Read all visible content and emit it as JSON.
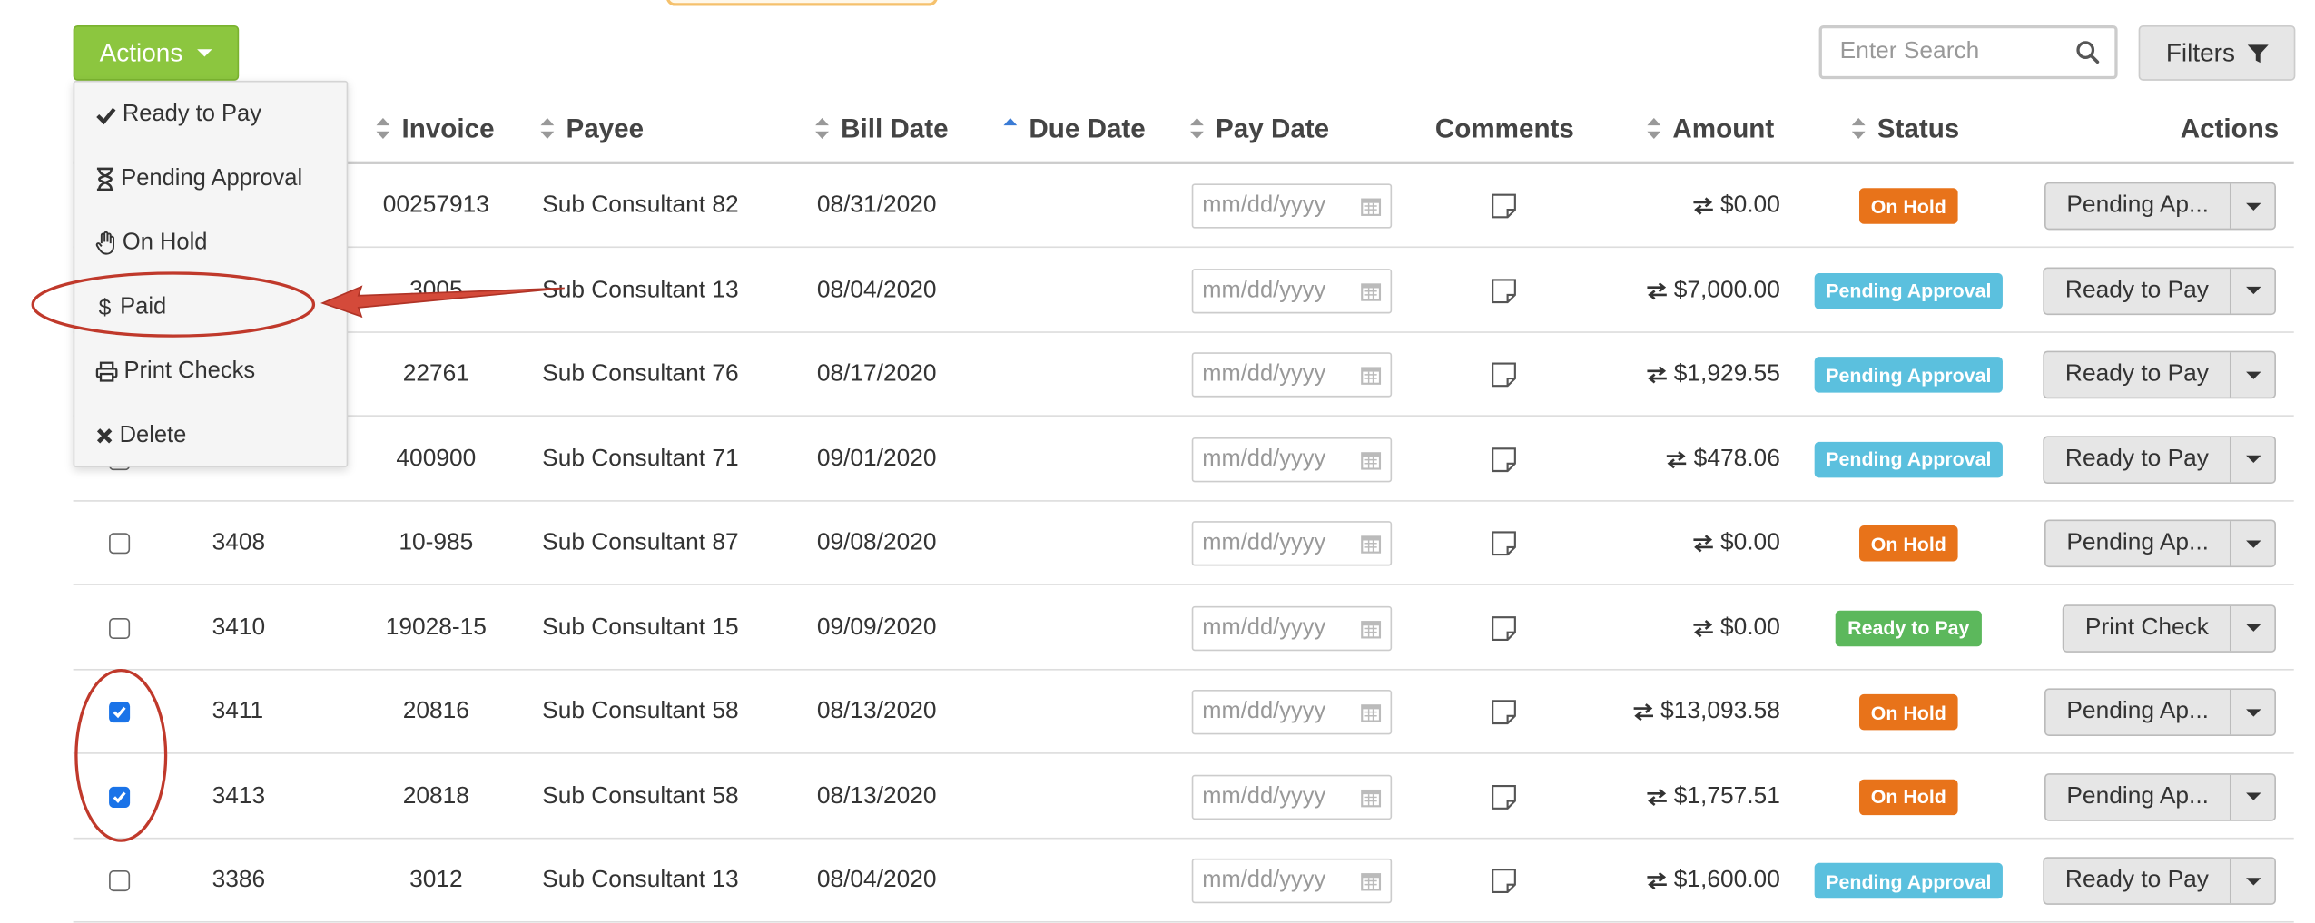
{
  "toolbar": {
    "actions_label": "Actions",
    "search_placeholder": "Enter Search",
    "filters_label": "Filters"
  },
  "actions_menu": [
    {
      "label": "Ready to Pay",
      "icon": "check-icon"
    },
    {
      "label": "Pending Approval",
      "icon": "hourglass-icon"
    },
    {
      "label": "On Hold",
      "icon": "hand-icon"
    },
    {
      "label": "Paid",
      "icon": "dollar-icon"
    },
    {
      "label": "Print Checks",
      "icon": "printer-icon"
    },
    {
      "label": "Delete",
      "icon": "times-icon"
    }
  ],
  "table": {
    "headers": {
      "invoice": "Invoice",
      "payee": "Payee",
      "bill_date": "Bill Date",
      "due_date": "Due Date",
      "pay_date": "Pay Date",
      "comments": "Comments",
      "amount": "Amount",
      "status": "Status",
      "actions": "Actions"
    },
    "date_placeholder": "mm/dd/yyyy",
    "rows": [
      {
        "checked": false,
        "id": "",
        "invoice": "00257913",
        "payee": "Sub Consultant 82",
        "bill_date": "08/31/2020",
        "amount": "$0.00",
        "status": "On Hold",
        "status_color": "#e8731a",
        "action": "Pending Ap..."
      },
      {
        "checked": false,
        "id": "",
        "invoice": "3005",
        "payee": "Sub Consultant 13",
        "bill_date": "08/04/2020",
        "amount": "$7,000.00",
        "status": "Pending Approval",
        "status_color": "#5bc0de",
        "action": "Ready to Pay"
      },
      {
        "checked": false,
        "id": "",
        "invoice": "22761",
        "payee": "Sub Consultant 76",
        "bill_date": "08/17/2020",
        "amount": "$1,929.55",
        "status": "Pending Approval",
        "status_color": "#5bc0de",
        "action": "Ready to Pay"
      },
      {
        "checked": false,
        "id": "",
        "invoice": "400900",
        "payee": "Sub Consultant 71",
        "bill_date": "09/01/2020",
        "amount": "$478.06",
        "status": "Pending Approval",
        "status_color": "#5bc0de",
        "action": "Ready to Pay"
      },
      {
        "checked": false,
        "id": "3408",
        "invoice": "10-985",
        "payee": "Sub Consultant 87",
        "bill_date": "09/08/2020",
        "amount": "$0.00",
        "status": "On Hold",
        "status_color": "#e8731a",
        "action": "Pending Ap..."
      },
      {
        "checked": false,
        "id": "3410",
        "invoice": "19028-15",
        "payee": "Sub Consultant 15",
        "bill_date": "09/09/2020",
        "amount": "$0.00",
        "status": "Ready to Pay",
        "status_color": "#5cb85c",
        "action": "Print Check"
      },
      {
        "checked": true,
        "id": "3411",
        "invoice": "20816",
        "payee": "Sub Consultant 58",
        "bill_date": "08/13/2020",
        "amount": "$13,093.58",
        "status": "On Hold",
        "status_color": "#e8731a",
        "action": "Pending Ap..."
      },
      {
        "checked": true,
        "id": "3413",
        "invoice": "20818",
        "payee": "Sub Consultant 58",
        "bill_date": "08/13/2020",
        "amount": "$1,757.51",
        "status": "On Hold",
        "status_color": "#e8731a",
        "action": "Pending Ap..."
      },
      {
        "checked": false,
        "id": "3386",
        "invoice": "3012",
        "payee": "Sub Consultant 13",
        "bill_date": "08/04/2020",
        "amount": "$1,600.00",
        "status": "Pending Approval",
        "status_color": "#5bc0de",
        "action": "Ready to Pay"
      }
    ]
  },
  "colors": {
    "actions_green": "#8cc63f",
    "annotation_red": "#c0392b"
  }
}
